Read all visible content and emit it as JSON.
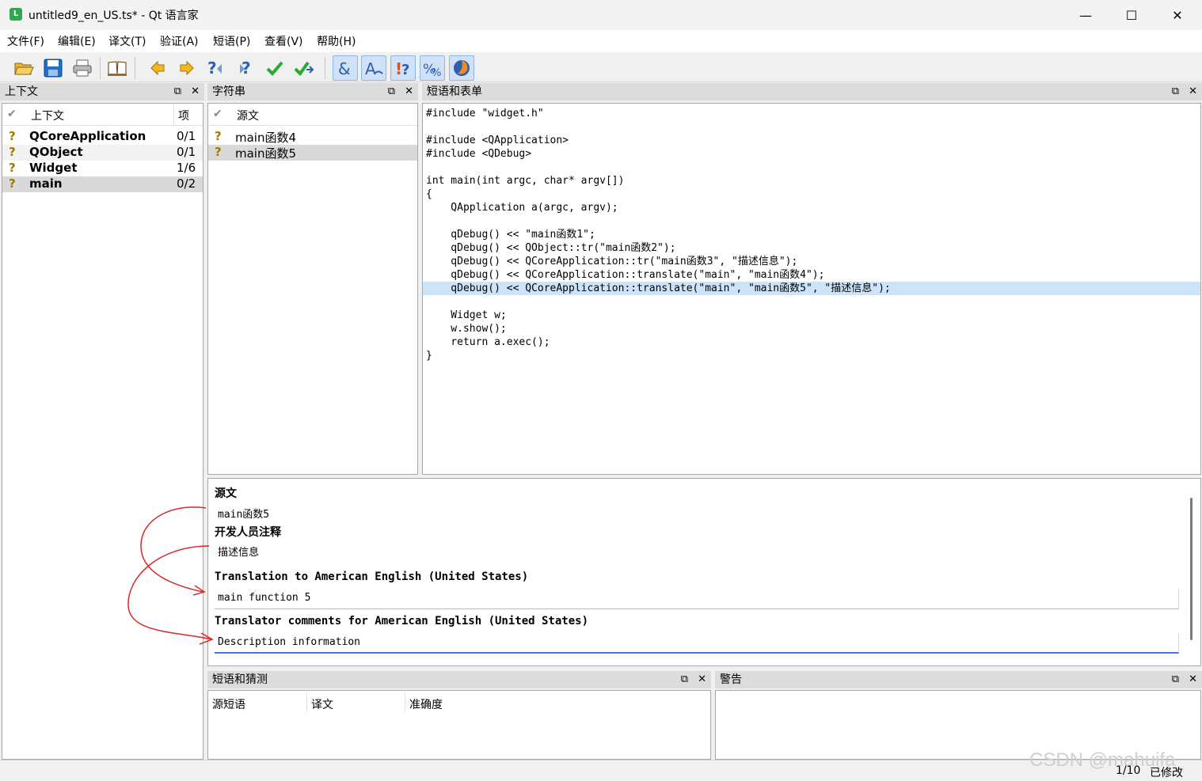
{
  "window": {
    "app_icon": "L",
    "title": "untitled9_en_US.ts* - Qt 语言家",
    "minimize": "—",
    "maximize": "☐",
    "close": "✕"
  },
  "menu": [
    "文件(F)",
    "编辑(E)",
    "译文(T)",
    "验证(A)",
    "短语(P)",
    "查看(V)",
    "帮助(H)"
  ],
  "toolbar": {
    "icons": [
      "open-icon",
      "save-icon",
      "print-icon",
      "phrasebook-icon",
      "prev-icon",
      "next-icon",
      "prev-unfinished-icon",
      "next-unfinished-icon",
      "done-icon",
      "done-next-icon",
      "accelerator-check-icon",
      "ending-punctuation-icon",
      "phrase-check-icon",
      "placemarker-check-icon",
      "surrounding-whitespace-icon"
    ]
  },
  "context_dock": {
    "title": "上下文",
    "col_context": "上下文",
    "col_items": "项",
    "rows": [
      {
        "name": "QCoreApplication",
        "count": "0/1"
      },
      {
        "name": "QObject",
        "count": "0/1"
      },
      {
        "name": "Widget",
        "count": "1/6"
      },
      {
        "name": "main",
        "count": "0/2"
      }
    ]
  },
  "strings_dock": {
    "title": "字符串",
    "col_source": "源文",
    "rows": [
      "main函数4",
      "main函数5"
    ]
  },
  "source_dock": {
    "title": "短语和表单",
    "lines": [
      "#include \"widget.h\"",
      "",
      "#include <QApplication>",
      "#include <QDebug>",
      "",
      "int main(int argc, char* argv[])",
      "{",
      "    QApplication a(argc, argv);",
      "",
      "    qDebug() << \"main函数1\";",
      "    qDebug() << QObject::tr(\"main函数2\");",
      "    qDebug() << QCoreApplication::tr(\"main函数3\", \"描述信息\");",
      "    qDebug() << QCoreApplication::translate(\"main\", \"main函数4\");",
      "    qDebug() << QCoreApplication::translate(\"main\", \"main函数5\", \"描述信息\");",
      "",
      "    Widget w;",
      "    w.show();",
      "    return a.exec();",
      "}"
    ]
  },
  "editor": {
    "source_label": "源文",
    "source_text": "main函数5",
    "dev_comment_label": "开发人员注释",
    "dev_comment_text": "描述信息",
    "translation_label": "Translation to American English (United States)",
    "translation_value": "main function 5",
    "translator_comment_label": "Translator comments for American English (United States)",
    "translator_comment_value": "Description information"
  },
  "phrases_dock": {
    "title": "短语和猜测",
    "col_source": "源短语",
    "col_translation": "译文",
    "col_accuracy": "准确度"
  },
  "warnings_dock": {
    "title": "警告"
  },
  "status": {
    "progress": "1/10",
    "modified": "已修改"
  },
  "watermark": "CSDN @mahuifa",
  "colors": {
    "accent": "#cde3f7",
    "annotation": "#d62a2a"
  }
}
